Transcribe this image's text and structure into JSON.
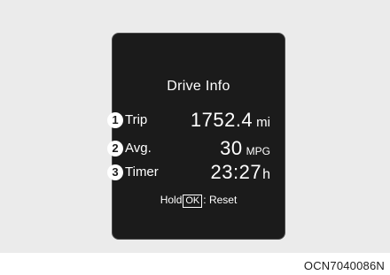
{
  "screen": {
    "title": "Drive Info",
    "rows": [
      {
        "num": "1",
        "label": "Trip",
        "value": "1752.4",
        "unit": "mi"
      },
      {
        "num": "2",
        "label": "Avg.",
        "value": "30",
        "unit": "MPG"
      },
      {
        "num": "3",
        "label": "Timer",
        "value": "23:27",
        "unit": "h"
      }
    ],
    "hold": {
      "prefix": "Hold",
      "key": "OK",
      "suffix": ": Reset"
    }
  },
  "figure_code": "OCN7040086N"
}
